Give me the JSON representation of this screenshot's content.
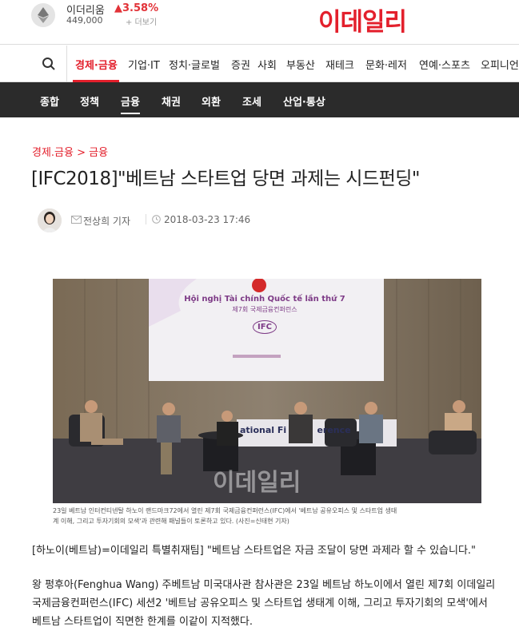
{
  "ticker": {
    "coin_name": "이더리움",
    "change": "▲3.58%",
    "price": "449,000",
    "more": "+ 더보기"
  },
  "logo": "이데일리",
  "nav": {
    "search_icon": "search-icon",
    "items": [
      "경제·금융",
      "기업·IT",
      "정치·글로벌",
      "증권",
      "사회",
      "부동산",
      "재테크",
      "문화·레저",
      "연예·스포츠",
      "오피니언"
    ],
    "active": "경제·금융"
  },
  "subnav": {
    "items": [
      "종합",
      "정책",
      "금융",
      "채권",
      "외환",
      "조세",
      "산업·통상"
    ],
    "active": "금융"
  },
  "article": {
    "breadcrumb": "경제.금융 > 금융",
    "title": "[IFC2018]\"베트남 스타트업 당면 과제는 시드펀딩\"",
    "author": "전상희 기자",
    "date": "2018-03-23 17:46",
    "photo": {
      "screen_line1": "Hội nghị Tài chính Quốc tế lần thứ 7",
      "screen_line2": "제7회 국제금융컨퍼런스",
      "screen_badge": "IFC",
      "banner": "ational Fi          erence",
      "watermark": "이데일리"
    },
    "caption_line1": "23일 베트남 인터컨티넨탈 하노이 랜드마크72에서 열린 제7회 국제금융컨퍼런스(IFC)에서 '베트남 공유오피스 및 스타트업 생태",
    "caption_line2": "계 이해, 그리고 투자기회의 모색'과 관련해 패널들이 토론하고 있다. (사진=신태현 기자)",
    "para1": "[하노이(베트남)=이데일리 특별취재팀] \"베트남 스타트업은 자금 조달이 당면 과제라 할 수 있습니다.\"",
    "para2_line1": "왕 펑후아(Fenghua Wang) 주베트남 미국대사관 참사관은 23일 베트남 하노이에서 열린 제7회 이데일리",
    "para2_line2": "국제금융컨퍼런스(IFC) 세션2 '베트남 공유오피스 및 스타트업 생태계 이해, 그리고 투자기회의 모색'에서",
    "para2_line3": "베트남 스타트업이 직면한 한계를 이같이 지적했다."
  },
  "colors": {
    "brand": "#e3202c",
    "subnav_bg": "#2b2b2b"
  }
}
